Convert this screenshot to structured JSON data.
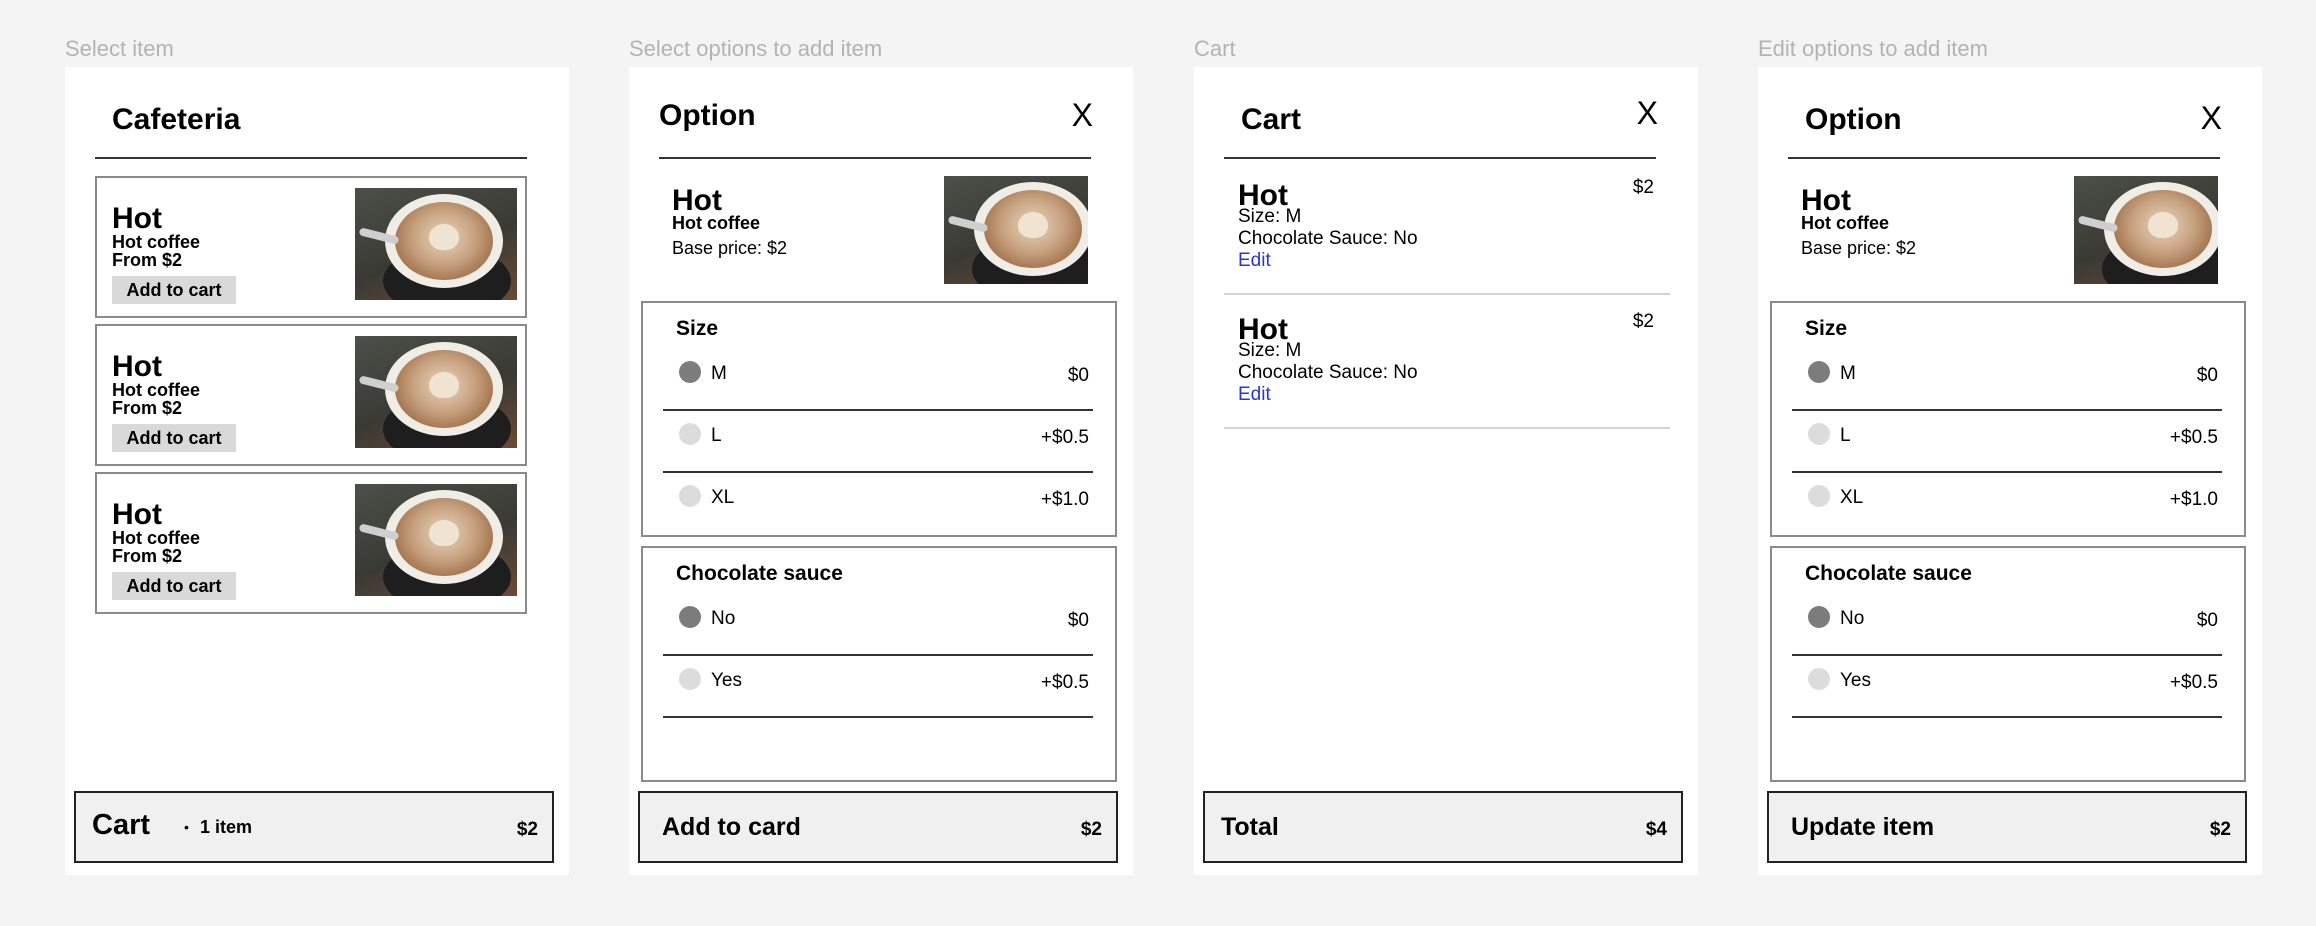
{
  "labels": {
    "select_item": "Select item",
    "select_options": "Select options to add item",
    "cart": "Cart",
    "edit_options": "Edit options to add item"
  },
  "menu": {
    "title": "Cafeteria",
    "items": [
      {
        "name": "Hot",
        "subtitle": "Hot coffee",
        "from": "From $2",
        "button": "Add to cart"
      },
      {
        "name": "Hot",
        "subtitle": "Hot coffee",
        "from": "From $2",
        "button": "Add to cart"
      },
      {
        "name": "Hot",
        "subtitle": "Hot coffee",
        "from": "From $2",
        "button": "Add to cart"
      }
    ],
    "cart_bar": {
      "label": "Cart",
      "items": "1 item",
      "price": "$2"
    }
  },
  "option": {
    "title": "Option",
    "close": "X",
    "item_name": "Hot",
    "item_subtitle": "Hot coffee",
    "base_price": "Base price: $2",
    "size_group": {
      "title": "Size",
      "options": [
        {
          "label": "M",
          "price": "$0",
          "selected": true
        },
        {
          "label": "L",
          "price": "+$0.5",
          "selected": false
        },
        {
          "label": "XL",
          "price": "+$1.0",
          "selected": false
        }
      ]
    },
    "sauce_group": {
      "title": "Chocolate sauce",
      "options": [
        {
          "label": "No",
          "price": "$0",
          "selected": true
        },
        {
          "label": "Yes",
          "price": "+$0.5",
          "selected": false
        }
      ]
    },
    "add_bar": {
      "label": "Add to card",
      "price": "$2"
    },
    "update_bar": {
      "label": "Update item",
      "price": "$2"
    }
  },
  "cart": {
    "title": "Cart",
    "close": "X",
    "entries": [
      {
        "name": "Hot",
        "price": "$2",
        "size": "Size: M",
        "sauce": "Chocolate Sauce: No",
        "edit": "Edit"
      },
      {
        "name": "Hot",
        "price": "$2",
        "size": "Size: M",
        "sauce": "Chocolate Sauce: No",
        "edit": "Edit"
      }
    ],
    "total_bar": {
      "label": "Total",
      "price": "$4"
    }
  },
  "colors": {
    "background": "#f4f4f4",
    "link": "#2a36d1",
    "bar": "#f0f0f0",
    "radio_selected": "#7c7c7c",
    "radio_unselected": "#dcdcdc"
  },
  "icons": [
    "close-icon",
    "coffee-image",
    "radio-icon",
    "bullet-icon"
  ]
}
